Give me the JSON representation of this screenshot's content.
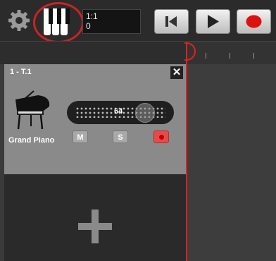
{
  "transport": {
    "time_bar": "1:1",
    "time_tick": "0"
  },
  "track": {
    "title": "1 - T.1",
    "close_label": "✕",
    "instrument_name": "Grand Piano",
    "volume_value": "64",
    "mute_label": "M",
    "solo_label": "S"
  },
  "colors": {
    "accent_red": "#d22222",
    "track_panel": "#8a8a8a",
    "record": "#e84a4a"
  },
  "icons": [
    "gear-icon",
    "piano-keys-icon",
    "rewind-icon",
    "play-icon",
    "record-icon",
    "grand-piano-icon",
    "close-icon",
    "add-track-icon"
  ]
}
